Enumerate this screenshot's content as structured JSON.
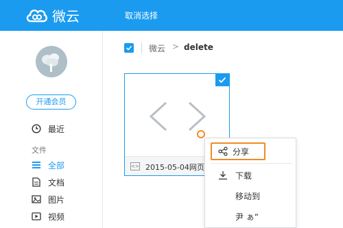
{
  "header": {
    "brand": "微云",
    "cancel_select": "取消选择"
  },
  "sidebar": {
    "vip_button": "开通会员",
    "recent": "最近",
    "section_files": "文件",
    "items": [
      {
        "label": "全部",
        "icon": "all-files-icon",
        "active": true
      },
      {
        "label": "文档",
        "icon": "document-icon",
        "active": false
      },
      {
        "label": "图片",
        "icon": "image-icon",
        "active": false
      },
      {
        "label": "视频",
        "icon": "video-icon",
        "active": false
      }
    ]
  },
  "breadcrumb": {
    "home": "微云",
    "separator": ">",
    "current": "delete"
  },
  "file": {
    "type_label": "<>",
    "name": "2015-05-04网页中"
  },
  "context_menu": {
    "share": "分享",
    "download": "下载",
    "move_to": "移动到",
    "partial": "尹 ぁ“"
  },
  "colors": {
    "accent": "#1a9bf0",
    "highlight": "#f08a24"
  }
}
